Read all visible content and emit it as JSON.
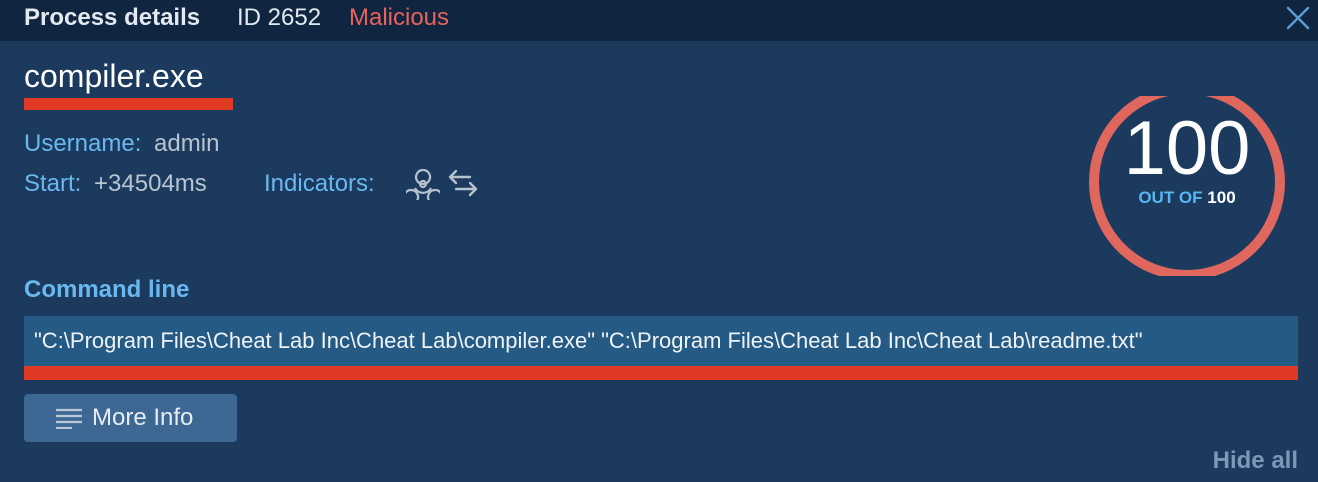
{
  "header": {
    "title": "Process details",
    "id_text": "ID 2652",
    "verdict": "Malicious",
    "verdict_color": "#e8635a",
    "close_icon": "close-icon"
  },
  "process": {
    "name": "compiler.exe",
    "username_label": "Username:",
    "username_value": "admin",
    "start_label": "Start:",
    "start_value": "+34504ms",
    "indicators_label": "Indicators:",
    "indicator_icons": [
      "biohazard-icon",
      "network-exchange-icon"
    ]
  },
  "score": {
    "value": "100",
    "out_of_label": "OUT OF",
    "max": "100",
    "ring_color": "#e0675e"
  },
  "command": {
    "label": "Command line",
    "text": "\"C:\\Program Files\\Cheat Lab Inc\\Cheat Lab\\compiler.exe\" \"C:\\Program Files\\Cheat Lab Inc\\Cheat Lab\\readme.txt\""
  },
  "actions": {
    "more_info": "More Info",
    "hide_all": "Hide all"
  },
  "highlight_color": "#e03a24"
}
